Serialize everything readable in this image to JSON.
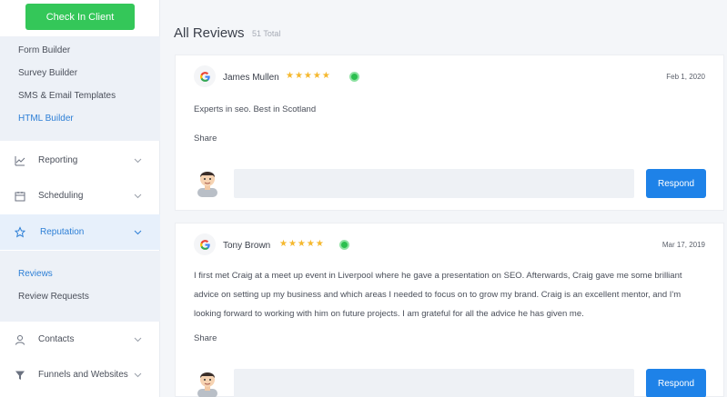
{
  "sidebar": {
    "checkin_label": "Check In Client",
    "sub_items_top": [
      "Form Builder",
      "Survey Builder",
      "SMS & Email Templates",
      "HTML Builder"
    ],
    "nav": {
      "reporting": "Reporting",
      "scheduling": "Scheduling",
      "reputation": "Reputation",
      "contacts": "Contacts",
      "funnels": "Funnels and Websites"
    },
    "sub_items_rep": [
      "Reviews",
      "Review Requests"
    ]
  },
  "header": {
    "title": "All Reviews",
    "total": "51 Total"
  },
  "reviews": [
    {
      "name": "James Mullen",
      "stars": "★★★★★",
      "date": "Feb 1, 2020",
      "text": "Experts in seo. Best in Scotland",
      "share": "Share",
      "respond": "Respond"
    },
    {
      "name": "Tony Brown",
      "stars": "★★★★★",
      "date": "Mar 17, 2019",
      "text": "I first met Craig at a meet up event in Liverpool where he gave a presentation on SEO. Afterwards, Craig gave me some brilliant advice on setting up my business and which areas I needed to focus on to grow my brand. Craig is an excellent mentor, and I'm looking forward to working with him on future projects. I am grateful for all the advice he has given me.",
      "share": "Share",
      "respond": "Respond"
    }
  ],
  "colors": {
    "accent": "#2d7fd6",
    "checkin": "#34c759",
    "respond": "#1e82e8",
    "star": "#f5b82e",
    "status": "#2bbf4f"
  }
}
